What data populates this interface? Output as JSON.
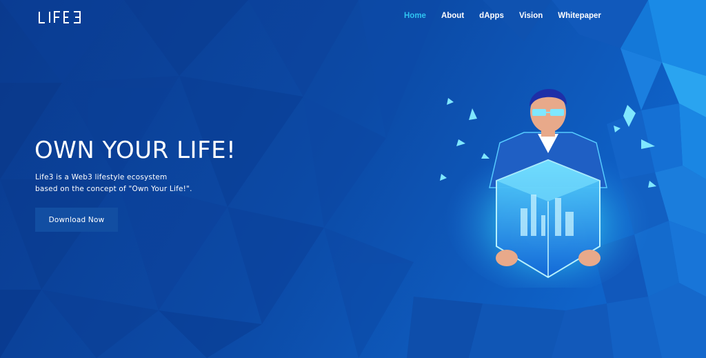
{
  "brand": {
    "logo_text": "LIFE3"
  },
  "nav": {
    "items": [
      {
        "label": "Home",
        "active": true
      },
      {
        "label": "About",
        "active": false
      },
      {
        "label": "dApps",
        "active": false
      },
      {
        "label": "Vision",
        "active": false
      },
      {
        "label": "Whitepaper",
        "active": false
      }
    ]
  },
  "hero": {
    "title": "OWN YOUR LIFE!",
    "subtitle_lines": [
      "Life3 is a Web3 lifestyle ecosystem",
      "based on the concept of \"Own Your Life!\"."
    ],
    "cta_label": "Download Now"
  },
  "colors": {
    "background": "#0a3f97",
    "accent": "#2fc4f2",
    "button_bg": "#124ea2"
  }
}
